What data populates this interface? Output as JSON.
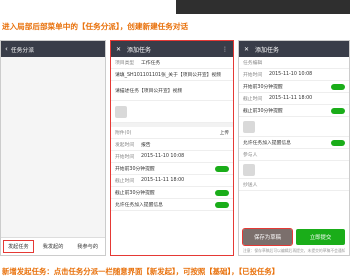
{
  "instructions": {
    "top": "进入局部后部菜单中的【任务分派】，创建新建任务对话",
    "bottom": "新增发起任务：点击任务分派一栏随意界面【新发起】，可按照【基础】，【已投任务】"
  },
  "phone1": {
    "title": "任务分派",
    "tabs": [
      "发起任务",
      "我发起的",
      "我参与的"
    ]
  },
  "phone2": {
    "title": "添加任务",
    "rows": [
      {
        "label": "项目类型",
        "value": "工作任务"
      },
      {
        "label": "",
        "value": "请填_SH101101101张_关于【项目公开宣】视频"
      },
      {
        "label": "",
        "value": "请描述任务【项目公开宣】视频"
      },
      {
        "label": "",
        "value": ""
      },
      {
        "label": "附件(0)",
        "value": "上传"
      },
      {
        "label": "发起时间",
        "value": "报告"
      },
      {
        "label": "开始时间",
        "value": "2015-11-10 10:08"
      },
      {
        "label": "",
        "value": "开始前30分钟提醒"
      },
      {
        "label": "截止时间",
        "value": "2015-11-11 18:00"
      },
      {
        "label": "",
        "value": "截止前30分钟提醒"
      },
      {
        "label": "",
        "value": "允许任务加入提醒信息"
      }
    ]
  },
  "phone3": {
    "title": "添加任务",
    "rows": [
      {
        "label": "任务编辑",
        "value": ""
      },
      {
        "label": "开始时间",
        "value": "2015-11-10 10:08"
      },
      {
        "label": "",
        "value": "开始前30分钟提醒"
      },
      {
        "label": "截止时间",
        "value": "2015-11-11 18:00"
      },
      {
        "label": "",
        "value": "截止前30分钟提醒"
      },
      {
        "label": "",
        "value": ""
      },
      {
        "label": "",
        "value": "允许任务加入提醒信息"
      },
      {
        "label": "参与人",
        "value": ""
      },
      {
        "label": "",
        "value": ""
      },
      {
        "label": "抄送人",
        "value": ""
      }
    ],
    "buttons": {
      "draft": "保存为草稿",
      "submit": "立即提交"
    },
    "note": "注意：保存草稿后可以编辑后再提交，未提交的草稿不会通知任何人"
  },
  "colors": {
    "header": "#393d49",
    "accent": "#1aad19",
    "highlight": "#e53935",
    "instruction": "#e8700a"
  }
}
